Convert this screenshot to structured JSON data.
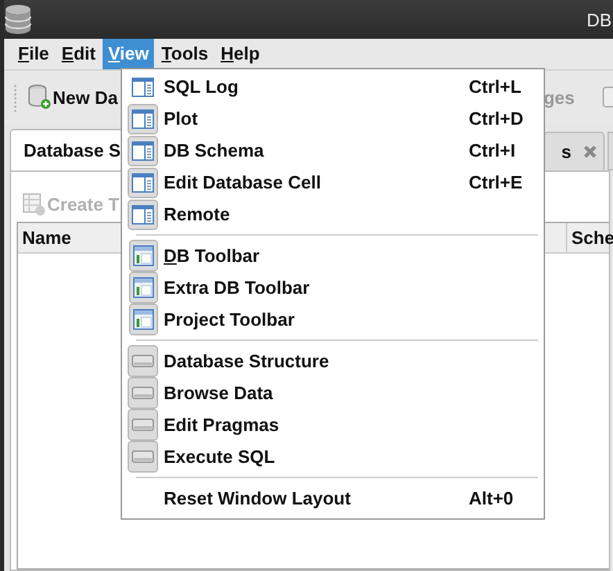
{
  "window": {
    "title": "DB"
  },
  "menubar": [
    {
      "mnemonic": "F",
      "rest": "ile",
      "selected": false
    },
    {
      "mnemonic": "E",
      "rest": "dit",
      "selected": false
    },
    {
      "mnemonic": "V",
      "rest": "iew",
      "selected": true
    },
    {
      "mnemonic": "T",
      "rest": "ools",
      "selected": false
    },
    {
      "mnemonic": "H",
      "rest": "elp",
      "selected": false
    }
  ],
  "toolbar": [
    {
      "label": "New Da",
      "disabled": false
    },
    {
      "label": "ges",
      "disabled": true
    }
  ],
  "tabs": [
    {
      "label": "Database S",
      "selected": true
    },
    {
      "label": "s",
      "selected": false
    }
  ],
  "create_button": {
    "label": "Create T",
    "disabled": true
  },
  "table": {
    "columns": [
      "Name",
      "Sche"
    ]
  },
  "menu": {
    "items": [
      {
        "kind": "panel",
        "label": "SQL Log",
        "shortcut": "Ctrl+L",
        "checked": false
      },
      {
        "kind": "panel",
        "label": "Plot",
        "shortcut": "Ctrl+D",
        "checked": true
      },
      {
        "kind": "panel",
        "label": "DB Schema",
        "shortcut": "Ctrl+I",
        "checked": true
      },
      {
        "kind": "panel",
        "label": "Edit Database Cell",
        "shortcut": "Ctrl+E",
        "checked": true
      },
      {
        "kind": "panel",
        "label": "Remote",
        "checked": true
      },
      {
        "kind": "separator"
      },
      {
        "kind": "toolbar",
        "mnemonic": "D",
        "label": "B Toolbar",
        "checked": true
      },
      {
        "kind": "toolbar",
        "label": "Extra DB Toolbar",
        "checked": true
      },
      {
        "kind": "toolbar",
        "label": "Project Toolbar",
        "checked": true
      },
      {
        "kind": "separator"
      },
      {
        "kind": "tab",
        "label": "Database Structure",
        "checked": true
      },
      {
        "kind": "tab",
        "label": "Browse Data",
        "checked": true
      },
      {
        "kind": "tab",
        "label": "Edit Pragmas",
        "checked": true
      },
      {
        "kind": "tab",
        "label": "Execute SQL",
        "checked": true
      },
      {
        "kind": "separator"
      },
      {
        "kind": "plain",
        "label": "Reset Window Layout",
        "shortcut": "Alt+0"
      }
    ]
  }
}
